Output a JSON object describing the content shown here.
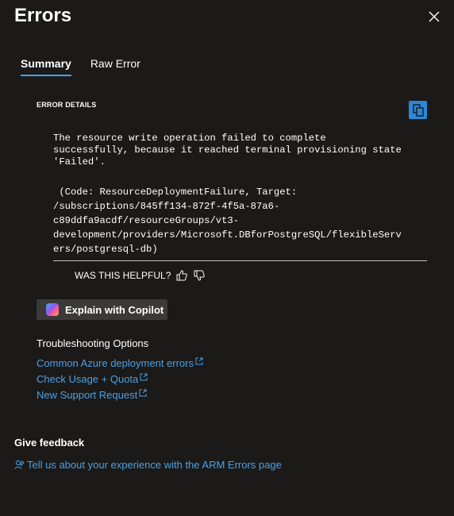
{
  "header": {
    "title": "Errors"
  },
  "tabs": [
    {
      "label": "Summary",
      "active": true
    },
    {
      "label": "Raw Error",
      "active": false
    }
  ],
  "error": {
    "section_label": "ERROR DETAILS",
    "message": "The resource write operation failed to complete\nsuccessfully, because it reached terminal provisioning state\n'Failed'.",
    "detail": " (Code: ResourceDeploymentFailure, Target:\n/subscriptions/845ff134-872f-4f5a-87a6-\nc89ddfa9acdf/resourceGroups/vt3-\ndevelopment/providers/Microsoft.DBforPostgreSQL/flexibleServ\ners/postgresql-db)"
  },
  "feedback_prompt": {
    "label": "WAS THIS HELPFUL?"
  },
  "copilot": {
    "label": "Explain with Copilot"
  },
  "troubleshooting": {
    "title": "Troubleshooting Options",
    "links": [
      "Common Azure deployment errors",
      "Check Usage + Quota",
      "New Support Request"
    ]
  },
  "give_feedback": {
    "title": "Give feedback",
    "link": "Tell us about your experience with the ARM Errors page"
  },
  "colors": {
    "background": "#1b1a19",
    "accent": "#2b88d8",
    "link": "#4aa0e6"
  }
}
